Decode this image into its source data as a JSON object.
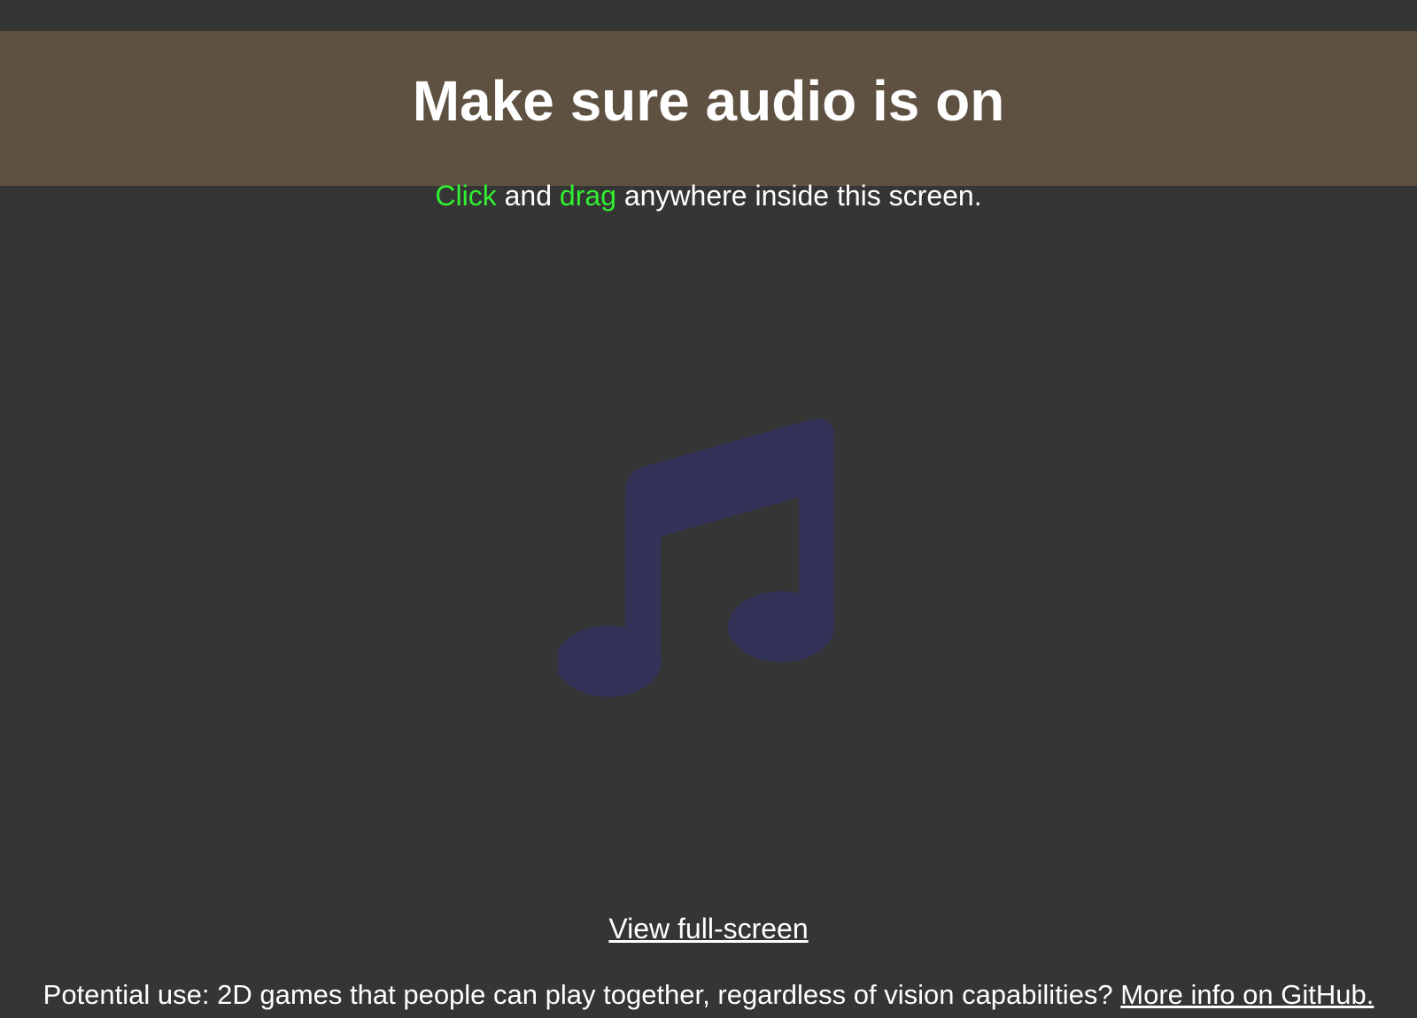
{
  "banner": {
    "title": "Make sure audio is on",
    "instruction": {
      "click_word": "Click",
      "and_word": " and ",
      "drag_word": "drag",
      "rest": " anywhere inside this screen."
    }
  },
  "play_area": {
    "icon": "music-note-icon"
  },
  "links": {
    "fullscreen": "View full-screen"
  },
  "footer": {
    "text": "Potential use: 2D games that people can play together, regardless of vision capabilities? ",
    "github_link": "More info on GitHub."
  },
  "colors": {
    "background": "#353535",
    "banner": "#5f5141",
    "accent": "#31f031",
    "icon": "#33335a",
    "text": "#ffffff"
  }
}
